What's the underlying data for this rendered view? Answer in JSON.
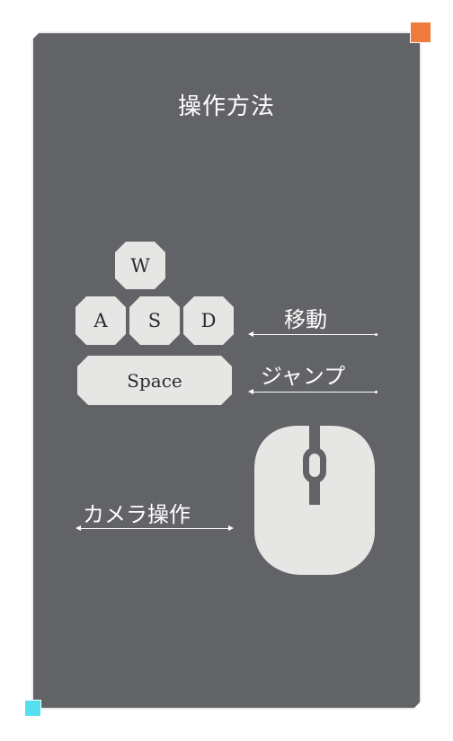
{
  "title": "操作方法",
  "keys": {
    "w": "W",
    "a": "A",
    "s": "S",
    "d": "D",
    "space": "Space"
  },
  "labels": {
    "move": "移動",
    "jump": "ジャンプ",
    "camera": "カメラ操作"
  },
  "icons": {
    "mouse": "mouse-icon"
  },
  "colors": {
    "panel": "#616366",
    "key": "#e6e6e4",
    "accent_orange": "#f07b3f",
    "accent_cyan": "#55dff0"
  }
}
